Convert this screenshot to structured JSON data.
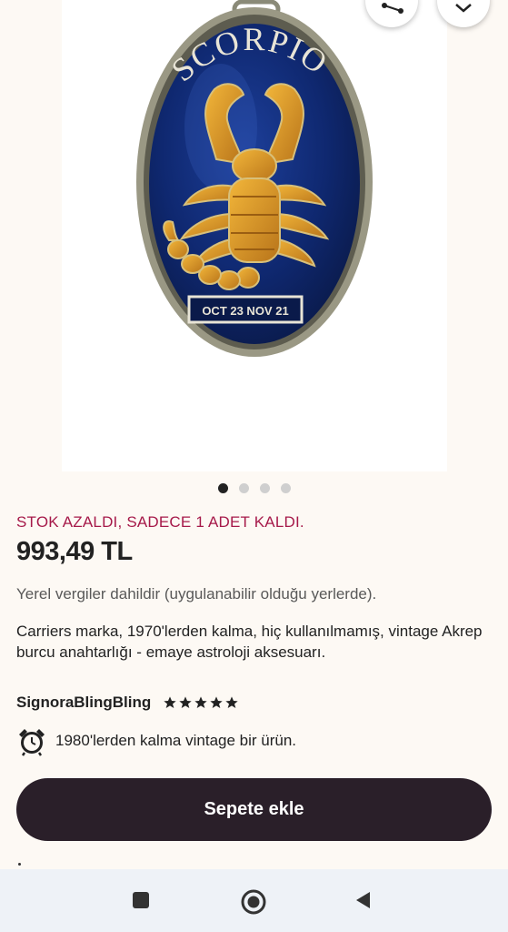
{
  "gallery": {
    "image_alt": "Scorpio enamel keychain",
    "keychain_title_text": "SCORPIO",
    "keychain_date_text": "OCT 23 NOV 21",
    "active_slide": 1,
    "slide_count": 4
  },
  "top_buttons": {
    "share_icon": "share-icon",
    "expand_icon": "chevron-down-icon"
  },
  "product": {
    "stock_warning": "STOK AZALDI, SADECE 1 ADET KALDI.",
    "price": "993,49 TL",
    "tax_note": "Yerel vergiler dahildir (uygulanabilir olduğu yerlerde).",
    "title": "Carriers marka, 1970'lerden kalma, hiç kullanılmamış, vintage Akrep burcu anahtarlığı - emaye astroloji aksesuarı.",
    "shop_name": "SignoraBlingBling",
    "rating": 5,
    "vintage_note": "1980'lerden kalma vintage bir ürün.",
    "vintage_icon": "alarm-clock-icon"
  },
  "actions": {
    "add_to_cart": "Sepete ekle"
  },
  "nav": {
    "recents_icon": "square-icon",
    "home_icon": "circle-home-icon",
    "back_icon": "triangle-back-icon"
  },
  "colors": {
    "stock_warning": "#a61a4a",
    "cart_button": "#2a1f29",
    "background": "#fdf9f4",
    "nav_bar": "#eef2f7"
  }
}
